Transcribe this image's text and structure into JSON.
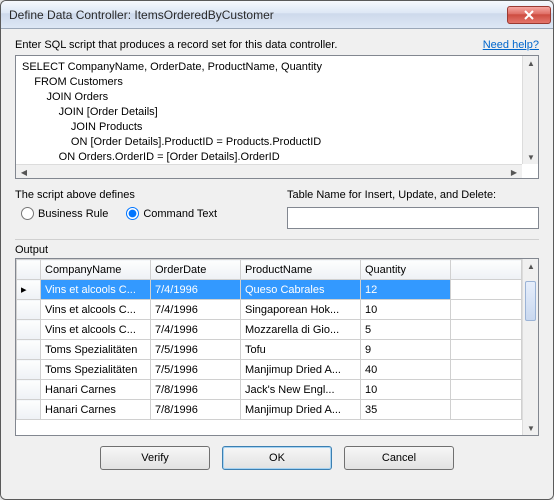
{
  "window": {
    "title": "Define Data Controller: ItemsOrderedByCustomer"
  },
  "prompt": "Enter SQL script that produces a record set for this data controller.",
  "help_link": "Need help?",
  "sql": "SELECT CompanyName, OrderDate, ProductName, Quantity\n    FROM Customers\n        JOIN Orders\n            JOIN [Order Details]\n                JOIN Products\n                ON [Order Details].ProductID = Products.ProductID\n            ON Orders.OrderID = [Order Details].OrderID\n        ON Customers.CustomerID = Orders.CustomerID ",
  "script_defines": {
    "label": "The script above defines",
    "options": {
      "business_rule": "Business Rule",
      "command_text": "Command Text"
    },
    "selected": "command_text"
  },
  "table_name": {
    "label": "Table Name for Insert, Update, and Delete:",
    "value": ""
  },
  "output": {
    "label": "Output",
    "columns": [
      "CompanyName",
      "OrderDate",
      "ProductName",
      "Quantity"
    ],
    "rows": [
      {
        "company": "Vins et alcools C...",
        "date": "7/4/1996",
        "product": "Queso Cabrales",
        "qty": "12",
        "selected": true,
        "indicator": "▸"
      },
      {
        "company": "Vins et alcools C...",
        "date": "7/4/1996",
        "product": "Singaporean Hok...",
        "qty": "10"
      },
      {
        "company": "Vins et alcools C...",
        "date": "7/4/1996",
        "product": "Mozzarella di Gio...",
        "qty": "5"
      },
      {
        "company": "Toms Spezialitäten",
        "date": "7/5/1996",
        "product": "Tofu",
        "qty": "9"
      },
      {
        "company": "Toms Spezialitäten",
        "date": "7/5/1996",
        "product": "Manjimup Dried A...",
        "qty": "40"
      },
      {
        "company": "Hanari Carnes",
        "date": "7/8/1996",
        "product": "Jack's New Engl...",
        "qty": "10"
      },
      {
        "company": "Hanari Carnes",
        "date": "7/8/1996",
        "product": "Manjimup Dried A...",
        "qty": "35"
      }
    ]
  },
  "buttons": {
    "verify": "Verify",
    "ok": "OK",
    "cancel": "Cancel"
  }
}
